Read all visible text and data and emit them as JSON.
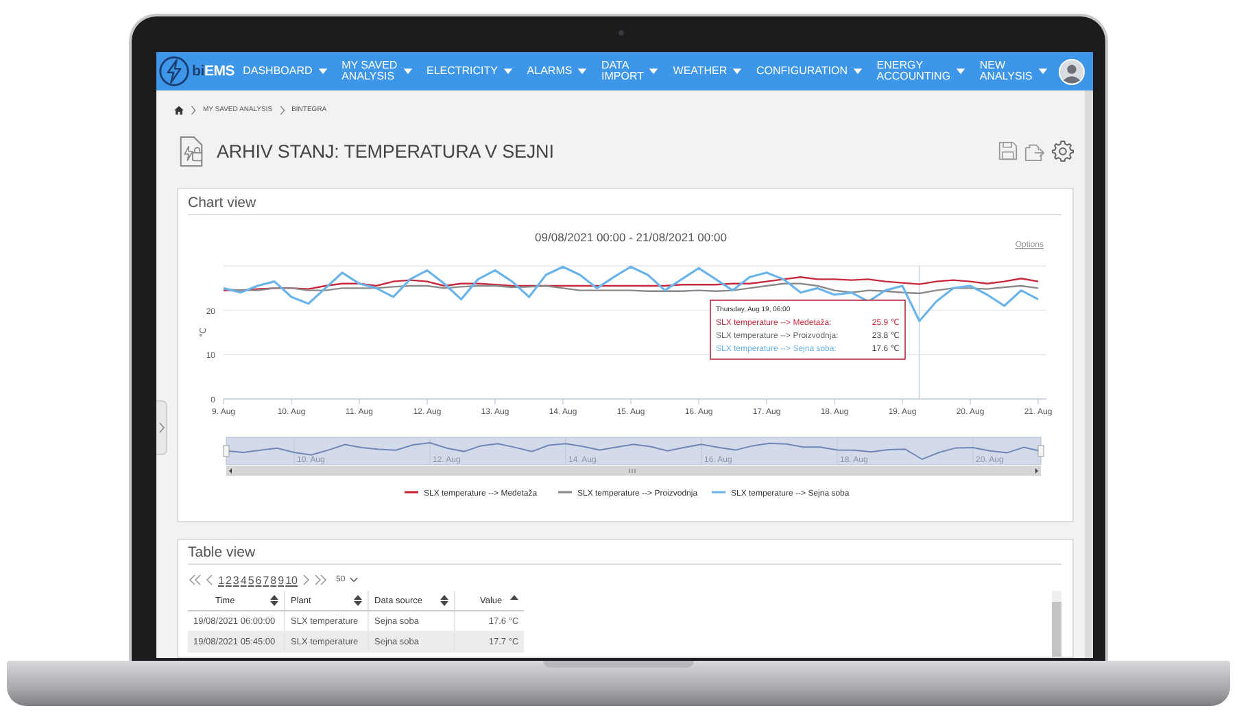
{
  "nav": {
    "logo": {
      "prefix": "bi",
      "name": "EMS"
    },
    "items": [
      {
        "lines": [
          "DASHBOARD"
        ]
      },
      {
        "lines": [
          "MY SAVED",
          "ANALYSIS"
        ]
      },
      {
        "lines": [
          "ELECTRICITY"
        ]
      },
      {
        "lines": [
          "ALARMS"
        ]
      },
      {
        "lines": [
          "DATA",
          "IMPORT"
        ]
      },
      {
        "lines": [
          "WEATHER"
        ]
      },
      {
        "lines": [
          "CONFIGURATION"
        ]
      },
      {
        "lines": [
          "ENERGY",
          "ACCOUNTING"
        ]
      },
      {
        "lines": [
          "NEW",
          "ANALYSIS"
        ]
      }
    ]
  },
  "breadcrumb": [
    "MY SAVED ANALYSIS",
    "BINTEGRA"
  ],
  "page_title": "ARHIV STANJ: TEMPERATURA V SEJNI",
  "chart_panel": {
    "title": "Chart view",
    "options_link": "Options",
    "chart_data": {
      "type": "line",
      "title": "09/08/2021 00:00 - 21/08/2021 00:00",
      "ylabel": "℃",
      "categories": [
        "9. Aug",
        null,
        null,
        null,
        "10. Aug",
        null,
        null,
        null,
        "11. Aug",
        null,
        null,
        null,
        "12. Aug",
        null,
        null,
        null,
        "13. Aug",
        null,
        null,
        null,
        "14. Aug",
        null,
        null,
        null,
        "15. Aug",
        null,
        null,
        null,
        "16. Aug",
        null,
        null,
        null,
        "17. Aug",
        null,
        null,
        null,
        "18. Aug",
        null,
        null,
        null,
        "19. Aug",
        null,
        null,
        null,
        "20. Aug",
        null,
        null,
        null,
        "21. Aug"
      ],
      "ylim": [
        0,
        30
      ],
      "yticks": [
        0,
        10,
        20
      ],
      "legend": "bottom",
      "series": [
        {
          "name": "SLX temperature --> Medetaža",
          "color": "#c8283c",
          "values": [
            24.5,
            24.5,
            24.8,
            25,
            25,
            24.8,
            25.5,
            26,
            26,
            25.5,
            26.5,
            26.8,
            26.5,
            25.5,
            26,
            26,
            25.8,
            25.5,
            25.5,
            25.5,
            25.5,
            25.5,
            25.5,
            25.5,
            25.5,
            25.5,
            25.5,
            25.8,
            25.8,
            25.8,
            26,
            26,
            26.5,
            27,
            27.5,
            27,
            27,
            26.8,
            27,
            26.5,
            26.2,
            25.9,
            26.5,
            26.8,
            26.5,
            26,
            26.5,
            27.2,
            26.5
          ]
        },
        {
          "name": "SLX temperature --> Proizvodnja",
          "color": "#8a8a8a",
          "values": [
            24.8,
            24.5,
            24.5,
            25,
            25,
            24.5,
            24.5,
            25,
            25,
            25,
            25.3,
            25.5,
            25.5,
            25,
            25.3,
            25.5,
            25.5,
            25.2,
            25.3,
            25.5,
            25,
            24.5,
            24.5,
            24.5,
            24.5,
            24.3,
            24.3,
            24.3,
            24.5,
            24.3,
            24.5,
            25,
            25.5,
            26,
            26,
            25.5,
            24.5,
            24,
            24.5,
            24.3,
            24,
            23.8,
            24.5,
            25,
            25,
            24.8,
            25.2,
            25.5,
            25
          ]
        },
        {
          "name": "SLX temperature --> Sejna soba",
          "color": "#6ab4ea",
          "values": [
            25,
            24,
            25.5,
            26.5,
            23,
            21.5,
            25,
            28.5,
            26,
            25,
            23,
            27,
            29,
            26,
            22.5,
            27,
            29,
            26.5,
            23,
            28,
            29.8,
            28,
            25,
            27.5,
            29.8,
            28,
            24.5,
            27,
            29.5,
            27,
            24.5,
            27.5,
            28.5,
            27,
            24,
            25,
            23.5,
            24,
            22,
            24.5,
            25.5,
            17.6,
            22,
            25,
            25.5,
            23.5,
            21,
            24.5,
            22.5
          ]
        }
      ]
    },
    "tooltip": {
      "title": "Thursday, Aug 19, 06:00",
      "rows": [
        {
          "label": "SLX temperature --> Medetaža:",
          "value": "25.9 ℃",
          "color": "#c8283c"
        },
        {
          "label": "SLX temperature --> Proizvodnja:",
          "value": "23.8 ℃",
          "color": "#666666"
        },
        {
          "label": "SLX temperature --> Sejna soba:",
          "value": "17.6 ℃",
          "color": "#6ab4ea"
        }
      ]
    },
    "navigator_labels": [
      "10. Aug",
      "12. Aug",
      "14. Aug",
      "16. Aug",
      "18. Aug",
      "20. Aug"
    ]
  },
  "table_panel": {
    "title": "Table view",
    "pages": [
      "1",
      "2",
      "3",
      "4",
      "5",
      "6",
      "7",
      "8",
      "9",
      "10"
    ],
    "page_size": "50",
    "columns": [
      {
        "label": "Time",
        "sorted": false
      },
      {
        "label": "Plant",
        "sorted": false
      },
      {
        "label": "Data source",
        "sorted": false
      },
      {
        "label": "Value",
        "sorted": true
      }
    ],
    "rows": [
      [
        "19/08/2021 06:00:00",
        "SLX temperature",
        "Sejna soba",
        "17.6 °C"
      ],
      [
        "19/08/2021 05:45:00",
        "SLX temperature",
        "Sejna soba",
        "17.7 °C"
      ]
    ]
  }
}
